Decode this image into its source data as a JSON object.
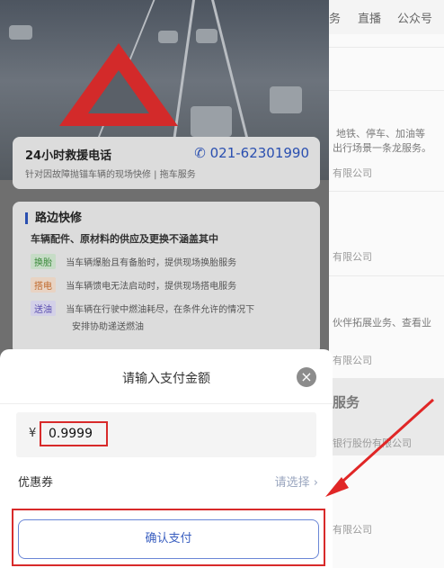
{
  "right_panel": {
    "nav": [
      "务",
      "直播",
      "公众号"
    ],
    "texts": [
      "地铁、停车、加油等",
      "出行场景一条龙服务。",
      "有限公司",
      "有限公司",
      "伙伴拓展业务、查看业",
      "有限公司",
      "服务",
      "银行股份有限公司",
      "有限公司"
    ]
  },
  "hotline": {
    "title": "24小时救援电话",
    "phone": "021-62301990",
    "subtitle": "针对因故障抛锚车辆的现场快修 | 拖车服务"
  },
  "service": {
    "title": "路边快修",
    "subtitle": "车辆配件、原材料的供应及更换不涵盖其中",
    "items": [
      {
        "tag": "换胎",
        "text": "当车辆爆胎且有备胎时，提供现场换胎服务"
      },
      {
        "tag": "搭电",
        "text": "当车辆馈电无法启动时，提供现场搭电服务"
      },
      {
        "tag": "送油",
        "text": "当车辆在行驶中燃油耗尽，在条件允许的情况下",
        "text2": "安排协助递送燃油"
      }
    ]
  },
  "payment_sheet": {
    "title": "请输入支付金额",
    "close_icon": "×",
    "currency": "¥",
    "amount": "0.9999",
    "coupon_label": "优惠券",
    "coupon_select": "请选择 ›",
    "confirm_label": "确认支付"
  },
  "colors": {
    "accent_blue": "#2a4fb0",
    "highlight_red": "#d82a2a"
  }
}
